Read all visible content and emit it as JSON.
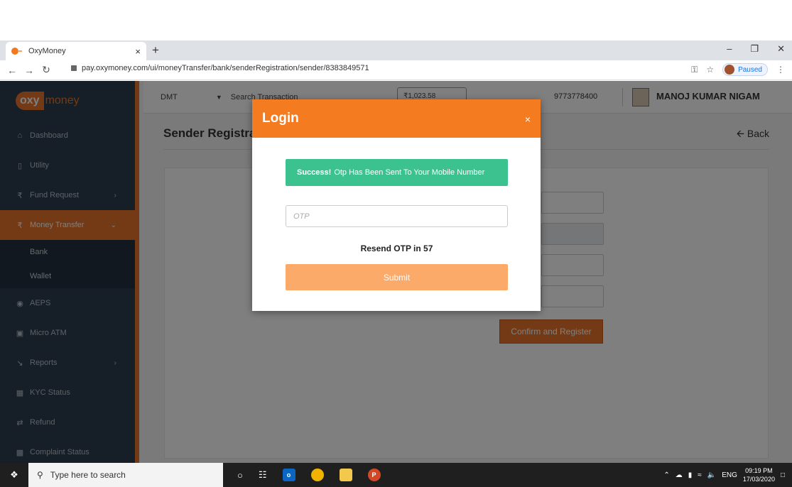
{
  "browser": {
    "tab_title": "OxyMoney",
    "tab_close": "×",
    "new_tab": "+",
    "url": "pay.oxymoney.com/ui/moneyTransfer/bank/senderRegistration/sender/8383849571",
    "paused_label": "Paused"
  },
  "sidebar": {
    "logo_oxy": "oxy",
    "logo_money": "money",
    "items": [
      {
        "label": "Dashboard",
        "icon": "home-icon"
      },
      {
        "label": "Utility",
        "icon": "phone-icon"
      },
      {
        "label": "Fund Request",
        "icon": "rupee-icon"
      },
      {
        "label": "Money Transfer",
        "icon": "rupee-icon"
      },
      {
        "label": "AEPS",
        "icon": "fingerprint-icon"
      },
      {
        "label": "Micro ATM",
        "icon": "atm-icon"
      },
      {
        "label": "Reports",
        "icon": "chart-icon"
      },
      {
        "label": "KYC Status",
        "icon": "id-card-icon"
      },
      {
        "label": "Refund",
        "icon": "refund-icon"
      },
      {
        "label": "Complaint Status",
        "icon": "comment-icon"
      }
    ],
    "subitems": [
      "Bank",
      "Wallet"
    ]
  },
  "topnav": {
    "service": "DMT",
    "search": "Search Transaction",
    "balance": "₹1,023.58",
    "phone": "9773778400",
    "user": "MANOJ KUMAR NIGAM"
  },
  "page": {
    "title": "Sender Registration",
    "back": "Back",
    "confirm_button": "Confirm and Register"
  },
  "modal": {
    "title": "Login",
    "close": "×",
    "alert_bold": "Success!",
    "alert_text": "Otp Has Been Sent To Your Mobile Number",
    "otp_placeholder": "OTP",
    "resend": "Resend OTP in 57",
    "submit": "Submit"
  },
  "taskbar": {
    "search_placeholder": "Type here to search",
    "lang": "ENG",
    "time": "09:19 PM",
    "date": "17/03/2020"
  },
  "colors": {
    "accent": "#f47b20",
    "sidebar": "#2c3e50",
    "success": "#3cc28f",
    "submit": "#fbaa6a"
  }
}
